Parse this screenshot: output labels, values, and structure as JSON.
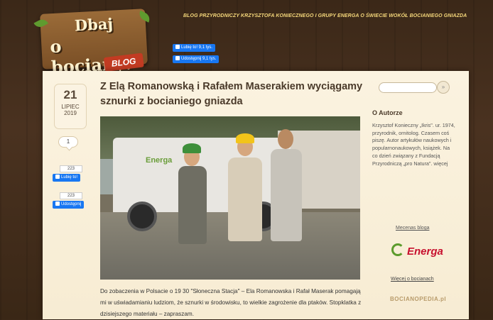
{
  "header": {
    "logo_line1": "Dbaj",
    "logo_line2": "o bociany!",
    "logo_badge": "BLOG",
    "tagline": "BLOG PRZYRODNICZY KRZYSZTOFA KONIECZNEGO I GRUPY ENERGA O ŚWIECIE WOKÓŁ BOCIANIEGO GNIAZDA",
    "fb_like": "Lubię to! 9,1 tys.",
    "fb_share": "Udostępnij 9,1 tys."
  },
  "post": {
    "date_day": "21",
    "date_month": "LIPIEC",
    "date_year": "2019",
    "comments_count": "1",
    "like_count": "223",
    "like_label": "Lubię to!",
    "share_count": "223",
    "share_label": "Udostępnij",
    "title": "Z Elą Romanowską i Rafałem Maserakiem wyciągamy sznurki z bocianiego gniazda",
    "photo_brand": "Energa",
    "caption": "Do zobaczenia w Polsacie o 19 30 \"Słoneczna Stacja\" – Ela Romanowska i Rafał Maserak pomagają mi w uświadamianiu ludziom, że sznurki w środowisku, to wielkie zagrożenie dla ptaków. Stopklatka z dzisiejszego materiału – zapraszam."
  },
  "sidebar": {
    "search_button": "»",
    "about_heading": "O Autorze",
    "about_text": "Krzysztof Konieczny „Ikris\". ur. 1974, przyrodnik, ornitolog. Czasem coś piszę. Autor artykułów naukowych i popularnonaukowych, książek. Na co dzień związany z Fundacją Przyrodniczą „pro Natura\". więcej",
    "patron_label": "Mecenas bloga",
    "patron_brand": "Energa",
    "more_link": "Więcej o bocianach",
    "bocian_site": "BOCIANOPEDIA.pl"
  },
  "colors": {
    "brand_green": "#5c9b2c",
    "energa_red": "#c7102e",
    "fb_blue": "#1877f2",
    "tagline_yellow": "#f4d77a"
  }
}
